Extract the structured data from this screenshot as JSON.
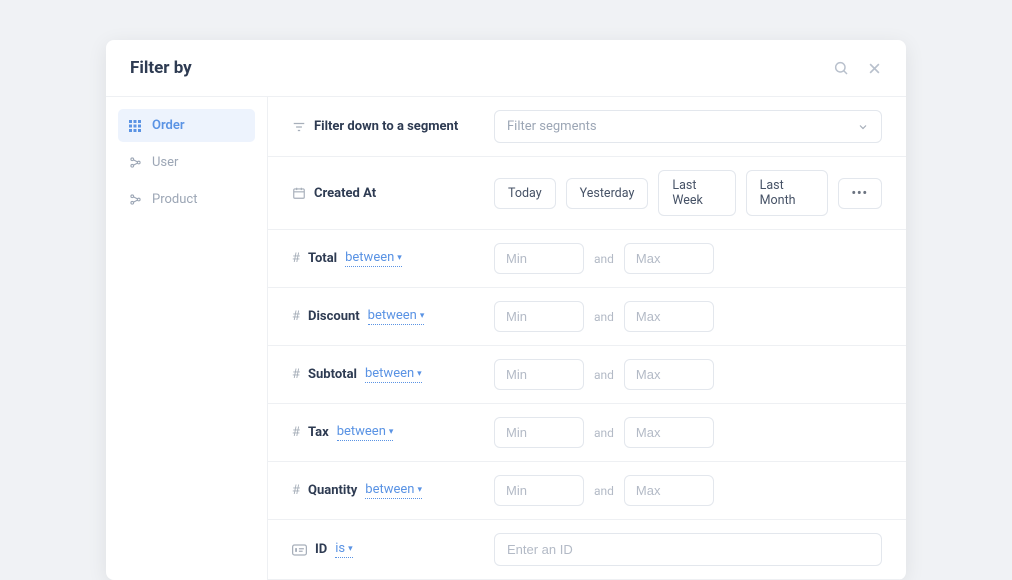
{
  "header": {
    "title": "Filter by"
  },
  "sidebar": {
    "items": [
      {
        "label": "Order",
        "active": true
      },
      {
        "label": "User",
        "active": false
      },
      {
        "label": "Product",
        "active": false
      }
    ]
  },
  "rows": {
    "segment": {
      "label": "Filter down to a segment",
      "placeholder": "Filter segments"
    },
    "created": {
      "label": "Created At",
      "chips": [
        "Today",
        "Yesterday",
        "Last Week",
        "Last Month"
      ]
    },
    "numeric": [
      {
        "name": "Total",
        "operator": "between",
        "min": "Min",
        "max": "Max",
        "and": "and"
      },
      {
        "name": "Discount",
        "operator": "between",
        "min": "Min",
        "max": "Max",
        "and": "and"
      },
      {
        "name": "Subtotal",
        "operator": "between",
        "min": "Min",
        "max": "Max",
        "and": "and"
      },
      {
        "name": "Tax",
        "operator": "between",
        "min": "Min",
        "max": "Max",
        "and": "and"
      },
      {
        "name": "Quantity",
        "operator": "between",
        "min": "Min",
        "max": "Max",
        "and": "and"
      }
    ],
    "id": {
      "name": "ID",
      "operator": "is",
      "placeholder": "Enter an ID"
    }
  }
}
